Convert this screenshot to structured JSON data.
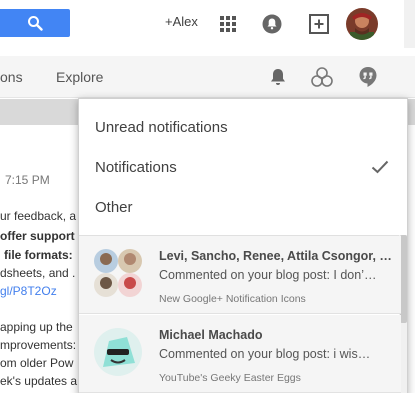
{
  "topbar": {
    "user_label": "+Alex",
    "icons": [
      "search-icon",
      "apps-grid-icon",
      "notification-bell-icon",
      "share-box-icon",
      "avatar"
    ]
  },
  "navbar": {
    "items": [
      {
        "label": "ons"
      },
      {
        "label": "Explore"
      }
    ],
    "icons": [
      "notifications-bell-icon",
      "circles-icon",
      "hangouts-icon"
    ]
  },
  "background_post": {
    "time": "7:15 PM",
    "lines": [
      "ur feedback, a",
      "offer support",
      "file formats:",
      "dsheets, and .",
      "gl/P8T2Oz",
      "apping up the",
      "mprovements:",
      "om older Pow",
      "ek's updates a"
    ]
  },
  "dropdown": {
    "options": [
      {
        "label": "Unread notifications",
        "selected": false
      },
      {
        "label": "Notifications",
        "selected": true
      },
      {
        "label": "Other",
        "selected": false
      }
    ],
    "notifications": [
      {
        "title": "Levi, Sancho, Renee, Attila Csongor, …",
        "body": "Commented on your blog post: I don’…",
        "source": "New Google+ Notification Icons"
      },
      {
        "title": "Michael Machado",
        "body": "Commented on your blog post: i wis…",
        "source": "YouTube's Geeky Easter Eggs"
      }
    ]
  },
  "colors": {
    "search_blue": "#4285f4",
    "link_blue": "#427fed",
    "panel_bg": "#ffffff",
    "notif_bg": "#f5f5f5"
  }
}
